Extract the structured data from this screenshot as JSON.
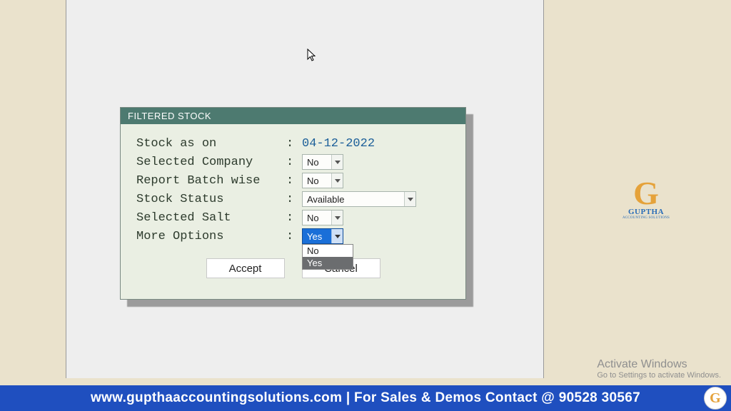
{
  "dialog": {
    "title": "FILTERED STOCK",
    "rows": {
      "stock_as_on": {
        "label": "Stock as on",
        "value": "04-12-2022"
      },
      "selected_company": {
        "label": "Selected Company",
        "value": "No"
      },
      "report_batch_wise": {
        "label": "Report Batch wise",
        "value": "No"
      },
      "stock_status": {
        "label": "Stock Status",
        "value": "Available"
      },
      "selected_salt": {
        "label": "Selected Salt",
        "value": "No"
      },
      "more_options": {
        "label": "More Options",
        "value": "Yes",
        "options": [
          "No",
          "Yes"
        ]
      }
    },
    "buttons": {
      "accept": "Accept",
      "cancel": "Cancel"
    }
  },
  "branding": {
    "logo_letter": "G",
    "logo_text": "GUPTHA",
    "logo_sub": "ACCOUNTING SOLUTIONS"
  },
  "watermark": {
    "line1": "Activate Windows",
    "line2": "Go to Settings to activate Windows."
  },
  "footer": {
    "text": "www.gupthaaccountingsolutions.com | For Sales & Demos Contact @ 90528 30567",
    "badge_letter": "G"
  }
}
